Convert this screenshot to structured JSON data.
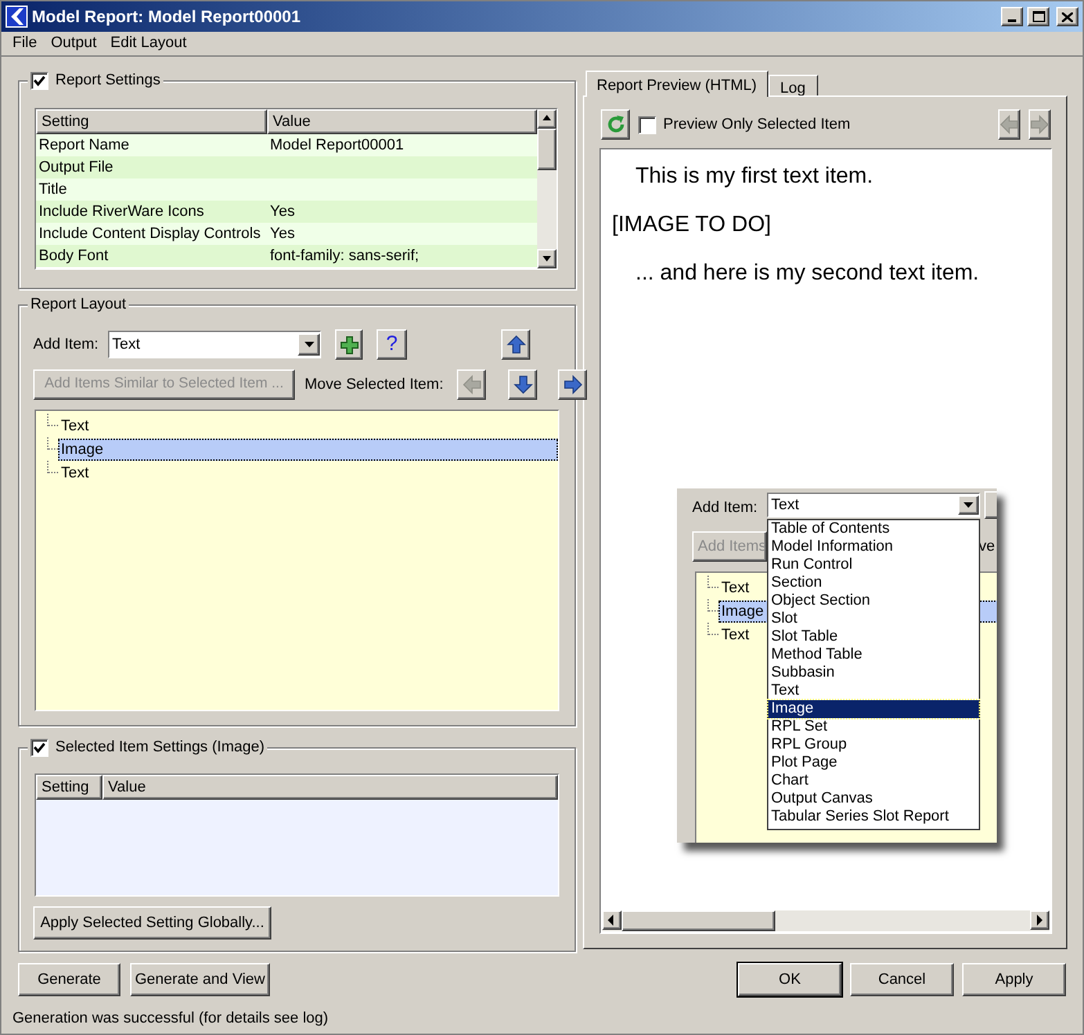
{
  "window": {
    "title": "Model Report: Model Report00001"
  },
  "menu": [
    "File",
    "Output",
    "Edit Layout"
  ],
  "report_settings": {
    "label": "Report Settings",
    "checked": true,
    "columns": [
      "Setting",
      "Value"
    ],
    "rows": [
      {
        "setting": "Report Name",
        "value": "Model Report00001"
      },
      {
        "setting": "Output File",
        "value": ""
      },
      {
        "setting": "Title",
        "value": ""
      },
      {
        "setting": "Include RiverWare Icons",
        "value": "Yes"
      },
      {
        "setting": "Include Content Display Controls",
        "value": "Yes"
      },
      {
        "setting": "Body Font",
        "value": "font-family: sans-serif;"
      }
    ]
  },
  "report_layout": {
    "label": "Report Layout",
    "add_item_label": "Add Item:",
    "add_item_value": "Text",
    "help_button": "?",
    "add_similar_button": {
      "label": "Add Items Similar to Selected Item ...",
      "disabled": true
    },
    "move_label": "Move Selected Item:",
    "move_buttons": [
      {
        "kind": "up",
        "disabled": false
      },
      {
        "kind": "left",
        "disabled": true
      },
      {
        "kind": "down",
        "disabled": false
      },
      {
        "kind": "right",
        "disabled": false
      }
    ],
    "items": [
      {
        "label": "Text",
        "selected": false
      },
      {
        "label": "Image",
        "selected": true
      },
      {
        "label": "Text",
        "selected": false
      }
    ]
  },
  "selected_item_settings": {
    "label": "Selected Item Settings (Image)",
    "checked": true,
    "columns": [
      "Setting",
      "Value"
    ],
    "apply_button": "Apply Selected Setting Globally..."
  },
  "left_buttons": [
    "Generate",
    "Generate and View"
  ],
  "tabs": [
    {
      "label": "Report Preview (HTML)",
      "selected": true
    },
    {
      "label": "Log",
      "selected": false
    }
  ],
  "preview": {
    "only_selected": {
      "label": "Preview Only Selected Item",
      "checked": false
    },
    "nav_buttons": [
      {
        "kind": "back",
        "disabled": true
      },
      {
        "kind": "forward",
        "disabled": true
      }
    ],
    "paragraphs": [
      {
        "kind": "indented",
        "text": "This is my first text item."
      },
      {
        "kind": "plain",
        "text": "[IMAGE TO DO]"
      },
      {
        "kind": "indented",
        "text": "... and here is my second text item."
      }
    ],
    "screenshot": {
      "add_item_label": "Add Item:",
      "add_item_value": "Text",
      "button_fragment": "Add Items",
      "label_fragment": "ve",
      "options": [
        {
          "label": "Table of Contents",
          "selected": false
        },
        {
          "label": "Model Information",
          "selected": false
        },
        {
          "label": "Run Control",
          "selected": false
        },
        {
          "label": "Section",
          "selected": false
        },
        {
          "label": "Object Section",
          "selected": false
        },
        {
          "label": "Slot",
          "selected": false
        },
        {
          "label": "Slot Table",
          "selected": false
        },
        {
          "label": "Method Table",
          "selected": false
        },
        {
          "label": "Subbasin",
          "selected": false
        },
        {
          "label": "Text",
          "selected": false
        },
        {
          "label": "Image",
          "selected": true
        },
        {
          "label": "RPL Set",
          "selected": false
        },
        {
          "label": "RPL Group",
          "selected": false
        },
        {
          "label": "Plot Page",
          "selected": false
        },
        {
          "label": "Chart",
          "selected": false
        },
        {
          "label": "Output Canvas",
          "selected": false
        },
        {
          "label": "Tabular Series Slot Report",
          "selected": false
        }
      ],
      "items": [
        {
          "label": "Text",
          "selected": false
        },
        {
          "label": "Image",
          "selected": true
        },
        {
          "label": "Text",
          "selected": false
        }
      ]
    }
  },
  "right_buttons": [
    "OK",
    "Cancel",
    "Apply"
  ],
  "status_bar": "Generation was successful (for details see log)"
}
